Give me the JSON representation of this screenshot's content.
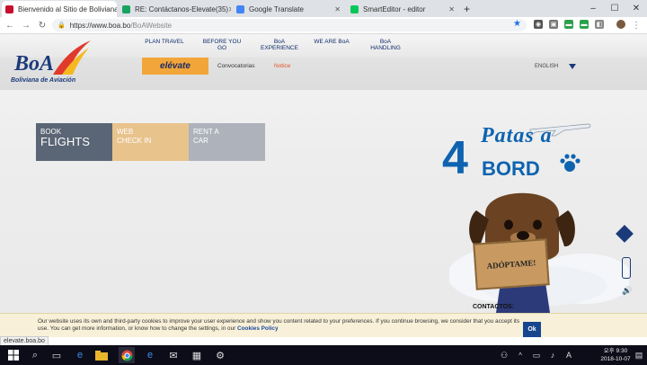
{
  "tabs": [
    {
      "label": "Bienvenido al Sitio de Boliviana",
      "favicon_color": "#c8102e"
    },
    {
      "label": "RE: Contáctanos-Elevate(35)",
      "favicon_color": "#1aa260"
    },
    {
      "label": "Google Translate",
      "favicon_color": "#4285f4"
    },
    {
      "label": "SmartEditor - editor",
      "favicon_color": "#03c75a"
    }
  ],
  "toolbar": {
    "url_prefix": "https://www.boa.bo",
    "url_path": "/BoAWebsite"
  },
  "site": {
    "logo_text": "BoA",
    "logo_sub": "Boliviana de Aviación",
    "nav": [
      "PLAN TRAVEL",
      "BEFORE YOU\nGO",
      "BoA\nEXPERIENCE",
      "WE ARE BoA",
      "BoA\nHANDLING"
    ],
    "elevate": "elévate",
    "subnav": {
      "convocatorias": "Convocatorias",
      "notice": "Notice"
    },
    "language": "ENGLISH",
    "tiles": [
      {
        "line1": "BOOK",
        "line2": "FLIGHTS",
        "color": "#5a6575"
      },
      {
        "line1": "WEB",
        "line2": "CHECK IN",
        "color": "#e8c38c"
      },
      {
        "line1": "RENT A",
        "line2": "CAR",
        "color": "#aeb2bb"
      }
    ],
    "promo": {
      "number": "4",
      "patas": "Patas a",
      "bord": "BORD",
      "sign": "ADÓPTAME!",
      "contacts": "CONTACTOS:"
    },
    "cookie": {
      "text": "Our website uses its own and third-party cookies to improve your user experience and show you content related to your preferences. If you continue browsing, we consider that you accept its use. You can get more information, or know how to change the settings, in our ",
      "link": "Cookies Policy",
      "ok": "Ok"
    }
  },
  "status": {
    "url": "elevate.boa.bo"
  },
  "clock": {
    "time": "오후 9:30",
    "date": "2018-10-07"
  }
}
